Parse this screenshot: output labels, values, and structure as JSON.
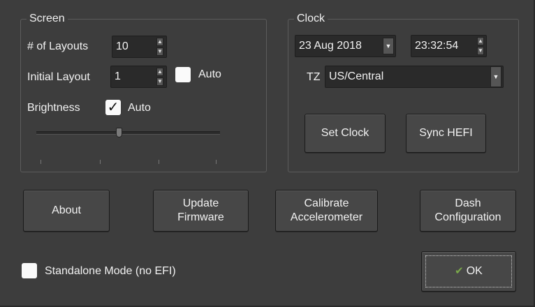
{
  "screen": {
    "title": "Screen",
    "layouts_label": "# of Layouts",
    "layouts_value": "10",
    "initial_layout_label": "Initial Layout",
    "initial_layout_value": "1",
    "initial_auto_label": "Auto",
    "initial_auto_checked": false,
    "brightness_label": "Brightness",
    "brightness_auto_checked": true,
    "brightness_auto_label": "Auto",
    "brightness_level_fraction": 0.45
  },
  "clock": {
    "title": "Clock",
    "date_value": "23 Aug 2018",
    "time_value": "23:32:54",
    "tz_label": "TZ",
    "tz_value": "US/Central",
    "set_clock_label": "Set Clock",
    "sync_label": "Sync HEFI"
  },
  "buttons": {
    "about": "About",
    "update_firmware_l1": "Update",
    "update_firmware_l2": "Firmware",
    "calibrate_l1": "Calibrate",
    "calibrate_l2": "Accelerometer",
    "dash_l1": "Dash",
    "dash_l2": "Configuration"
  },
  "standalone": {
    "label": "Standalone Mode (no EFI)",
    "checked": false
  },
  "ok": {
    "label": "OK",
    "icon": "check-icon"
  },
  "colors": {
    "background": "#3d3d3d",
    "field": "#2a2a2a",
    "button": "#474747",
    "text": "#f2f2f2",
    "ok_icon": "#7aa84a"
  }
}
